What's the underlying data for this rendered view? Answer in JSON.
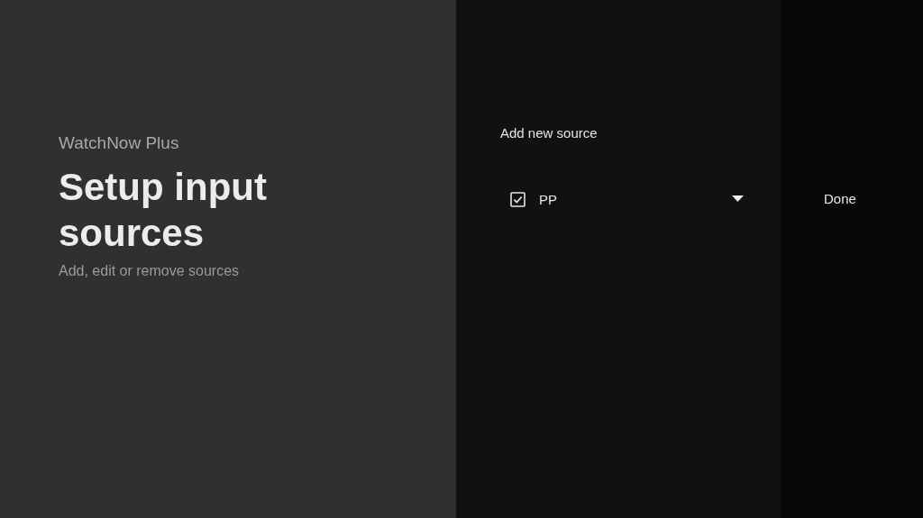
{
  "app": {
    "name": "WatchNow Plus",
    "title": "Setup input sources",
    "subtitle": "Add, edit or remove sources"
  },
  "sources": {
    "heading": "Add new source",
    "items": [
      {
        "label": "PP",
        "checked": true
      }
    ]
  },
  "actions": [
    {
      "label": "Done"
    }
  ]
}
